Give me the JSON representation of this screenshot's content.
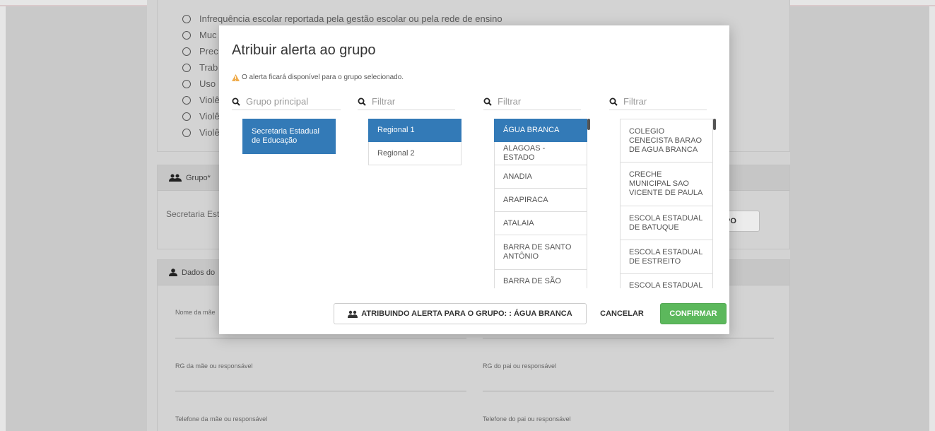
{
  "background": {
    "radio_options": [
      "Infrequência escolar reportada pela gestão escolar ou pela rede de ensino",
      "Muc",
      "Prec",
      "Trab",
      "Uso",
      "Violê",
      "Violê",
      "Violê"
    ],
    "grupo_panel": {
      "title": "Grupo*",
      "value": "Secretaria Est",
      "button_label": "PO"
    },
    "dados_panel": {
      "title": "Dados do",
      "fields": {
        "mae_nome": "Nome da mãe",
        "rg_mae": "RG da mãe ou responsável",
        "rg_pai": "RG do pai ou responsável",
        "tel_mae": "Telefone da mãe ou responsável",
        "tel_pai": "Telefone do pai ou responsável"
      }
    }
  },
  "modal": {
    "title": "Atribuir alerta ao grupo",
    "warning": "O alerta ficará disponível para o grupo selecionado.",
    "columns": [
      {
        "placeholder": "Grupo principal",
        "items": [
          {
            "label": "Secretaria Estadual de Educação",
            "active": true
          }
        ]
      },
      {
        "placeholder": "Filtrar",
        "items": [
          {
            "label": "Regional 1",
            "active": true
          },
          {
            "label": "Regional 2",
            "active": false
          }
        ]
      },
      {
        "placeholder": "Filtrar",
        "items": [
          {
            "label": "ÁGUA BRANCA",
            "active": true
          },
          {
            "label": "ALAGOAS - ESTADO",
            "active": false
          },
          {
            "label": "ANADIA",
            "active": false
          },
          {
            "label": "ARAPIRACA",
            "active": false
          },
          {
            "label": "ATALAIA",
            "active": false
          },
          {
            "label": "BARRA DE SANTO ANTÔNIO",
            "active": false
          },
          {
            "label": "BARRA DE SÃO",
            "active": false
          }
        ]
      },
      {
        "placeholder": "Filtrar",
        "items": [
          {
            "label": "COLEGIO CENECISTA BARAO DE AGUA BRANCA",
            "active": false
          },
          {
            "label": "CRECHE MUNICIPAL SAO VICENTE DE PAULA",
            "active": false
          },
          {
            "label": "ESCOLA ESTADUAL DE BATUQUE",
            "active": false
          },
          {
            "label": "ESCOLA ESTADUAL DE ESTREITO",
            "active": false
          },
          {
            "label": "ESCOLA ESTADUAL",
            "active": false
          }
        ]
      }
    ],
    "footer": {
      "group_info": "ATRIBUINDO ALERTA PARA O GRUPO: : ÁGUA BRANCA",
      "cancel": "CANCELAR",
      "confirm": "CONFIRMAR"
    }
  },
  "colors": {
    "primary": "#337ab7",
    "success": "#5cb85c",
    "warning": "#f0ad4e"
  }
}
